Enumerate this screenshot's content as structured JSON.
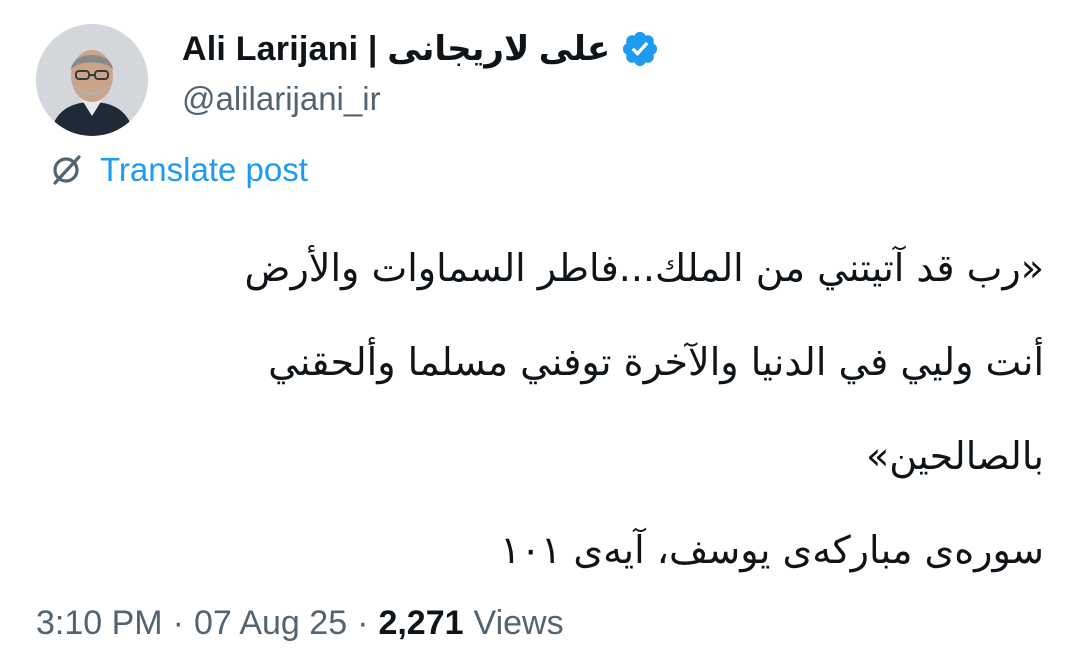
{
  "author": {
    "display_name": "Ali Larijani | علی لاریجانی",
    "handle": "@alilarijani_ir",
    "verified_icon": "verified-badge-icon",
    "avatar_icon": "profile-avatar"
  },
  "translate": {
    "icon": "globe-translate-icon",
    "label": "Translate post"
  },
  "post": {
    "lines": [
      "«رب قد آتيتني من الملك...فاطر السماوات والأرض",
      "أنت وليي في الدنيا والآخرة توفني مسلما وألحقني",
      "بالصالحين»",
      "سوره‌ی مبارکه‌ی یوسف، آیه‌ی ۱۰۱"
    ]
  },
  "meta": {
    "time": "3:10 PM",
    "date": "07 Aug 25",
    "views_count": "2,271",
    "views_label": "Views",
    "separator": "·"
  },
  "colors": {
    "text": "#0f1419",
    "secondary": "#536471",
    "accent": "#1d9bf0"
  }
}
